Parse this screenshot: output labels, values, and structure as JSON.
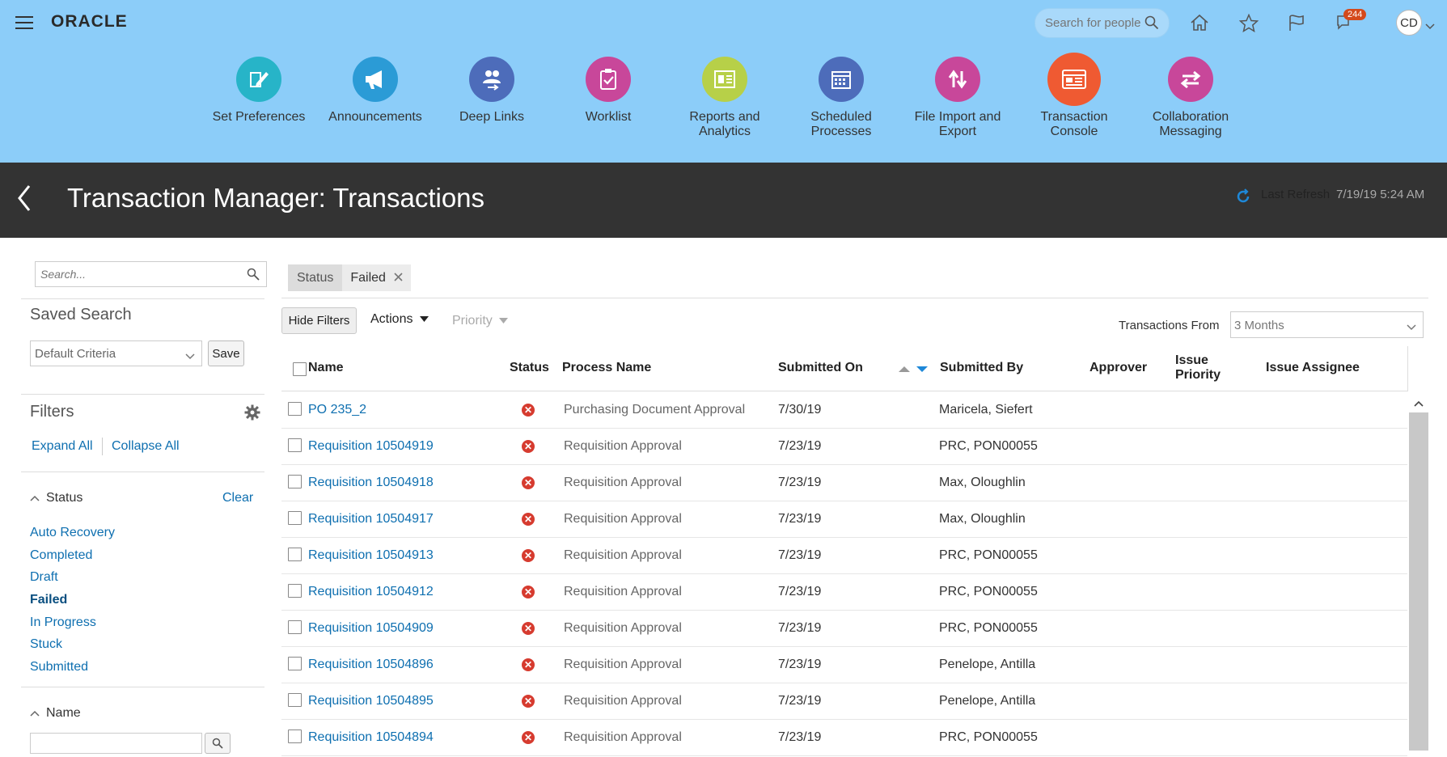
{
  "header": {
    "brand": "ORACLE",
    "search_placeholder": "Search for people",
    "notifications_count": "244",
    "user_initials": "CD"
  },
  "springboard": [
    {
      "label": "Set Preferences",
      "icon": "pen-paper-icon",
      "color": "#27b4c8"
    },
    {
      "label": "Announcements",
      "icon": "megaphone-icon",
      "color": "#2b9bd6"
    },
    {
      "label": "Deep Links",
      "icon": "people-link-icon",
      "color": "#4d6cba"
    },
    {
      "label": "Worklist",
      "icon": "clipboard-check-icon",
      "color": "#c8479a"
    },
    {
      "label": "Reports and Analytics",
      "icon": "report-icon",
      "color": "#b7d048"
    },
    {
      "label": "Scheduled Processes",
      "icon": "calendar-icon",
      "color": "#4d6cba"
    },
    {
      "label": "File Import and Export",
      "icon": "up-down-arrows-icon",
      "color": "#c8479a"
    },
    {
      "label": "Transaction Console",
      "icon": "console-icon",
      "color": "#ef5a32"
    },
    {
      "label": "Collaboration Messaging",
      "icon": "swap-arrows-icon",
      "color": "#c8479a"
    }
  ],
  "title_bar": {
    "title": "Transaction Manager: Transactions",
    "last_refresh_label": "Last Refresh",
    "last_refresh_value": "7/19/19 5:24 AM"
  },
  "left_panel": {
    "search_placeholder": "Search...",
    "saved_search_heading": "Saved Search",
    "saved_search_value": "Default Criteria",
    "save_label": "Save",
    "filters_heading": "Filters",
    "expand_all": "Expand All",
    "collapse_all": "Collapse All",
    "status_heading": "Status",
    "clear_label": "Clear",
    "status_options": [
      "Auto Recovery",
      "Completed",
      "Draft",
      "Failed",
      "In Progress",
      "Stuck",
      "Submitted"
    ],
    "status_selected": "Failed",
    "name_heading": "Name"
  },
  "filter_chip": {
    "label": "Status",
    "value": "Failed"
  },
  "toolbar": {
    "hide_filters": "Hide Filters",
    "actions": "Actions",
    "priority": "Priority",
    "transactions_from_label": "Transactions From",
    "transactions_from_value": "3 Months"
  },
  "table": {
    "columns": {
      "name": "Name",
      "status": "Status",
      "process": "Process Name",
      "submitted_on": "Submitted On",
      "submitted_by": "Submitted By",
      "approver": "Approver",
      "issue_priority_1": "Issue",
      "issue_priority_2": "Priority",
      "issue_assignee": "Issue Assignee"
    },
    "rows": [
      {
        "name": "PO 235_2",
        "process": "Purchasing Document Approval",
        "submitted_on": "7/30/19",
        "submitted_by": "Maricela, Siefert"
      },
      {
        "name": "Requisition 10504919",
        "process": "Requisition Approval",
        "submitted_on": "7/23/19",
        "submitted_by": "PRC, PON00055"
      },
      {
        "name": "Requisition 10504918",
        "process": "Requisition Approval",
        "submitted_on": "7/23/19",
        "submitted_by": "Max, Oloughlin"
      },
      {
        "name": "Requisition 10504917",
        "process": "Requisition Approval",
        "submitted_on": "7/23/19",
        "submitted_by": "Max, Oloughlin"
      },
      {
        "name": "Requisition 10504913",
        "process": "Requisition Approval",
        "submitted_on": "7/23/19",
        "submitted_by": "PRC, PON00055"
      },
      {
        "name": "Requisition 10504912",
        "process": "Requisition Approval",
        "submitted_on": "7/23/19",
        "submitted_by": "PRC, PON00055"
      },
      {
        "name": "Requisition 10504909",
        "process": "Requisition Approval",
        "submitted_on": "7/23/19",
        "submitted_by": "PRC, PON00055"
      },
      {
        "name": "Requisition 10504896",
        "process": "Requisition Approval",
        "submitted_on": "7/23/19",
        "submitted_by": "Penelope, Antilla"
      },
      {
        "name": "Requisition 10504895",
        "process": "Requisition Approval",
        "submitted_on": "7/23/19",
        "submitted_by": "Penelope, Antilla"
      },
      {
        "name": "Requisition 10504894",
        "process": "Requisition Approval",
        "submitted_on": "7/23/19",
        "submitted_by": "PRC, PON00055"
      }
    ]
  }
}
